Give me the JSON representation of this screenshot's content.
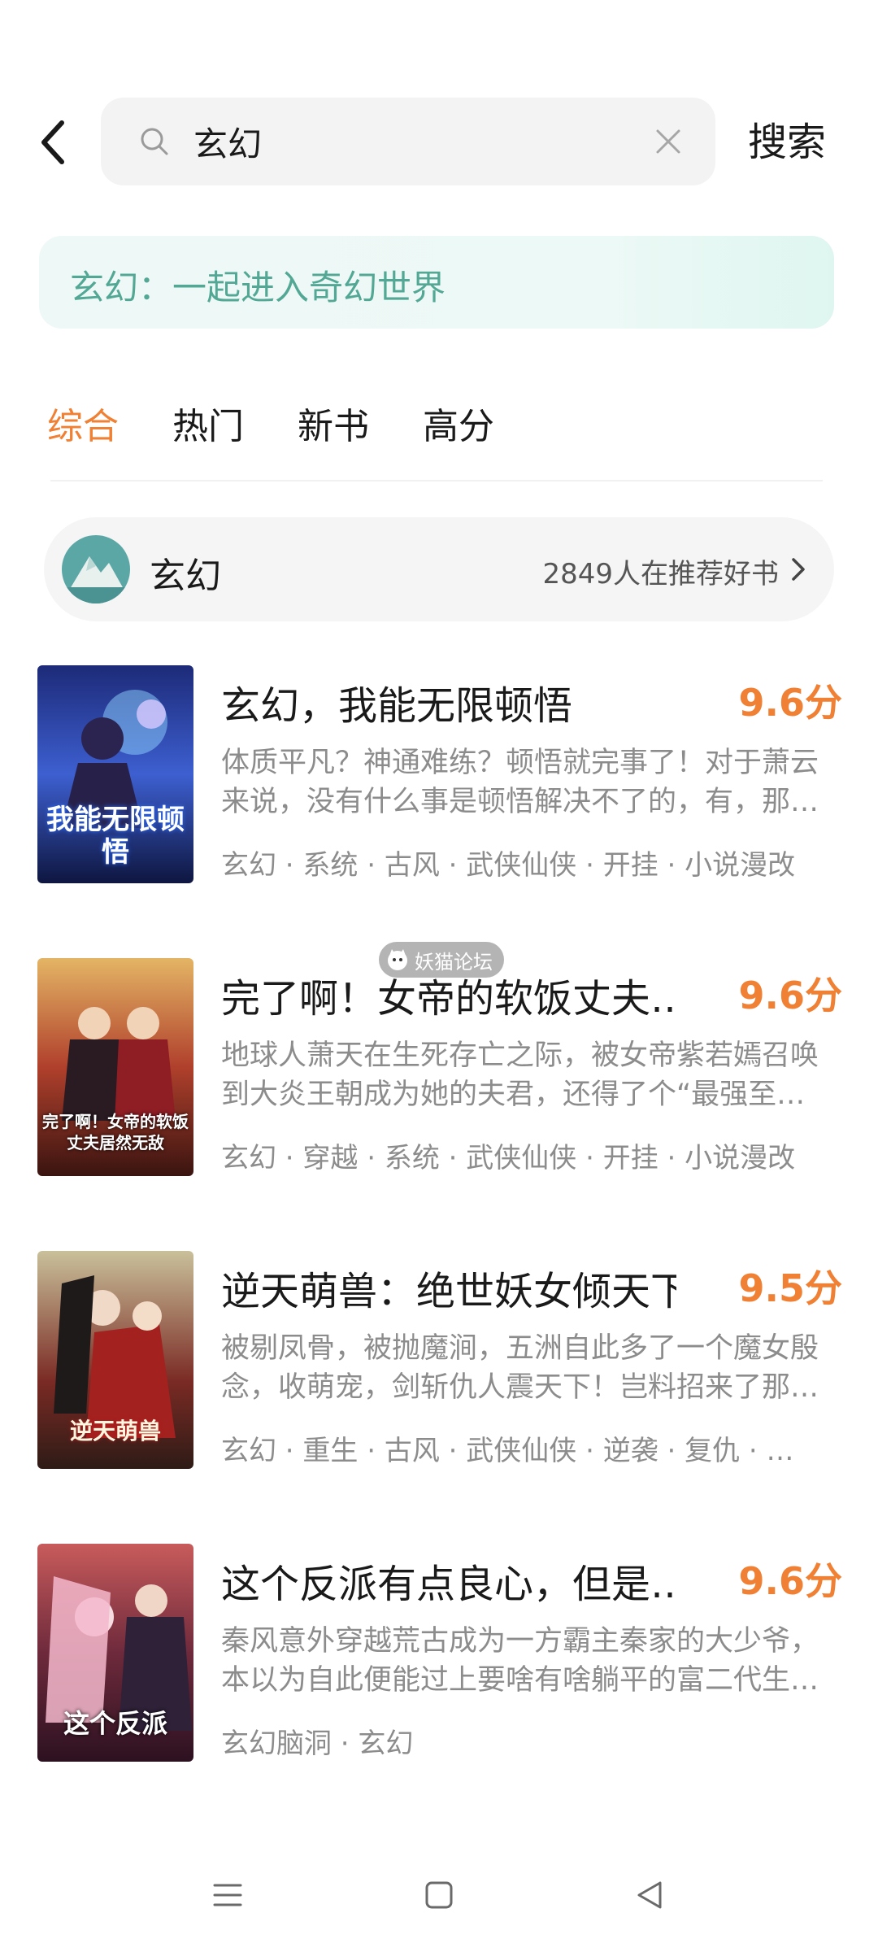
{
  "header": {
    "search_value": "玄幻",
    "search_button": "搜索"
  },
  "banner": {
    "text": "玄幻：一起进入奇幻世界"
  },
  "tabs": [
    {
      "label": "综合",
      "active": true
    },
    {
      "label": "热门",
      "active": false
    },
    {
      "label": "新书",
      "active": false
    },
    {
      "label": "高分",
      "active": false
    }
  ],
  "topic": {
    "name": "玄幻",
    "count_text": "2849人在推荐好书"
  },
  "watermark": {
    "text": "妖猫论坛"
  },
  "books": [
    {
      "title": "玄幻，我能无限顿悟",
      "score": "9.6分",
      "desc": "体质平凡？神通难练？顿悟就完事了！对于萧云来说，没有什么事是顿悟解决不了的，有，那…",
      "tags": "玄幻 · 系统 · 古风 · 武侠仙侠 · 开挂 · 小说漫改",
      "cover_text": "我能无限顿悟"
    },
    {
      "title": "完了啊！女帝的软饭丈夫…",
      "score": "9.6分",
      "desc": "地球人萧天在生死存亡之际，被女帝紫若嫣召唤到大炎王朝成为她的夫君，还得了个“最强至…",
      "tags": "玄幻 · 穿越 · 系统 · 武侠仙侠 · 开挂 · 小说漫改",
      "cover_text": "完了啊！女帝的软饭丈夫居然无敌"
    },
    {
      "title": "逆天萌兽：绝世妖女倾天下",
      "score": "9.5分",
      "desc": "被剔凤骨，被抛魔涧，五洲自此多了一个魔女殷念，收萌宠，剑斩仇人震天下！岂料招来了那…",
      "tags": "玄幻 · 重生 · 古风 · 武侠仙侠 · 逆袭 · 复仇 · …",
      "cover_text": "逆天萌兽"
    },
    {
      "title": "这个反派有点良心，但是…",
      "score": "9.6分",
      "desc": "秦风意外穿越荒古成为一方霸主秦家的大少爷，本以为自此便能过上要啥有啥躺平的富二代生…",
      "tags": "玄幻脑洞 · 玄幻",
      "cover_text": "这个反派"
    }
  ],
  "colors": {
    "accent": "#f08033",
    "banner_text": "#52a894",
    "secondary_text": "#8c8c8c"
  }
}
